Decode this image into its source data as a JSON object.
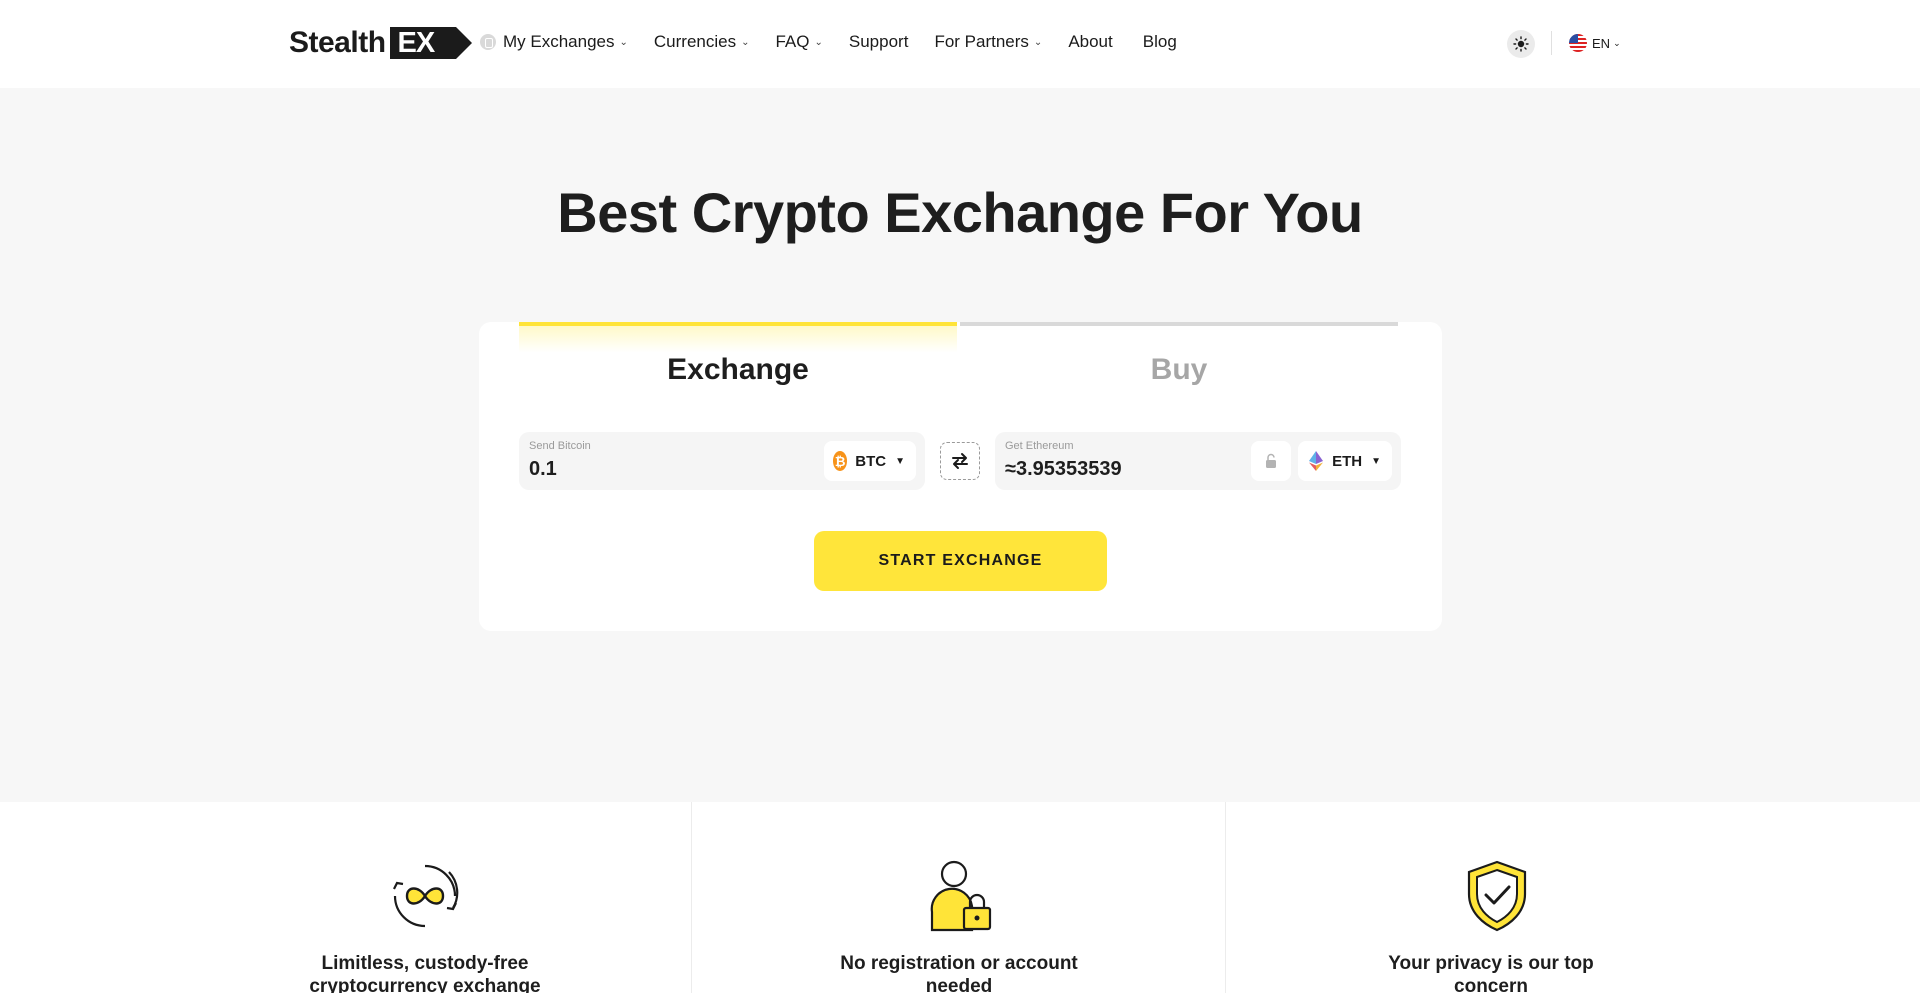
{
  "header": {
    "logo_text": "Stealth",
    "logo_badge": "EX",
    "nav": [
      {
        "label": "My Exchanges",
        "has_dropdown": true
      },
      {
        "label": "Currencies",
        "has_dropdown": true
      },
      {
        "label": "FAQ",
        "has_dropdown": true
      },
      {
        "label": "Support",
        "has_dropdown": false
      },
      {
        "label": "For Partners",
        "has_dropdown": true
      },
      {
        "label": "About",
        "has_dropdown": false
      },
      {
        "label": "Blog",
        "has_dropdown": false
      }
    ],
    "theme_icon": "sun-icon",
    "language": "EN"
  },
  "hero": {
    "title": "Best Crypto Exchange For You"
  },
  "widget": {
    "tabs": {
      "exchange": "Exchange",
      "buy": "Buy"
    },
    "active_tab": "exchange",
    "send": {
      "label": "Send Bitcoin",
      "value": "0.1",
      "currency": "BTC"
    },
    "get": {
      "label": "Get Ethereum",
      "value": "≈3.95353539",
      "currency": "ETH"
    },
    "start_button": "START EXCHANGE"
  },
  "features": [
    {
      "icon": "infinity-exchange-icon",
      "title": "Limitless, custody-free cryptocurrency exchange"
    },
    {
      "icon": "user-lock-icon",
      "title": "No registration or account needed"
    },
    {
      "icon": "shield-check-icon",
      "title": "Your privacy is our top concern"
    }
  ],
  "colors": {
    "accent": "#ffe53a",
    "background": "#f7f7f7",
    "text": "#1e1e1e"
  }
}
